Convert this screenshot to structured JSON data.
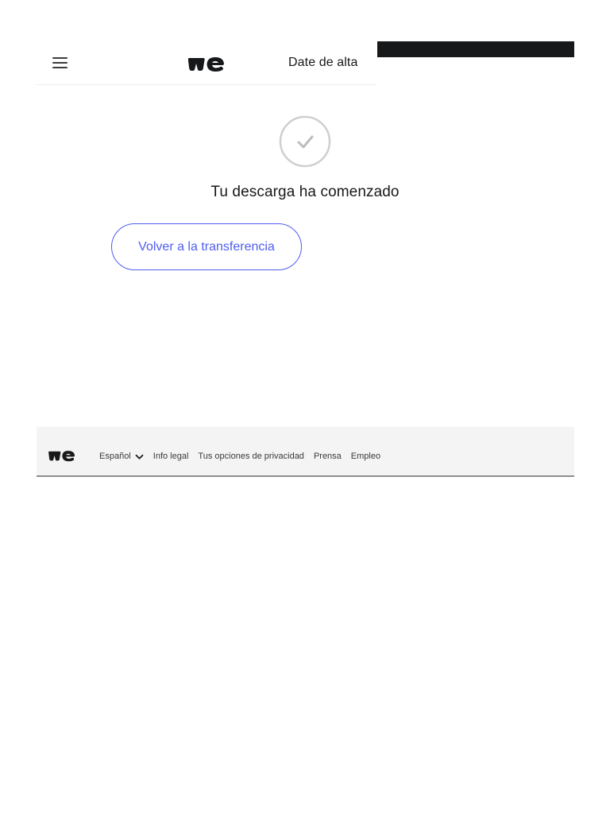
{
  "header": {
    "signup_label": "Date de alta"
  },
  "main": {
    "status_title": "Tu descarga ha comenzado",
    "back_button_label": "Volver a la transferencia"
  },
  "footer": {
    "language": "Español",
    "links": [
      "Info legal",
      "Tus opciones de privacidad",
      "Prensa",
      "Empleo"
    ]
  },
  "colors": {
    "accent": "#4f5cf0",
    "text": "#17181a",
    "footer_bg": "#f4f4f4"
  },
  "icons": [
    "menu-icon",
    "wetransfer-logo",
    "check-circle-icon",
    "chevron-down-icon"
  ]
}
